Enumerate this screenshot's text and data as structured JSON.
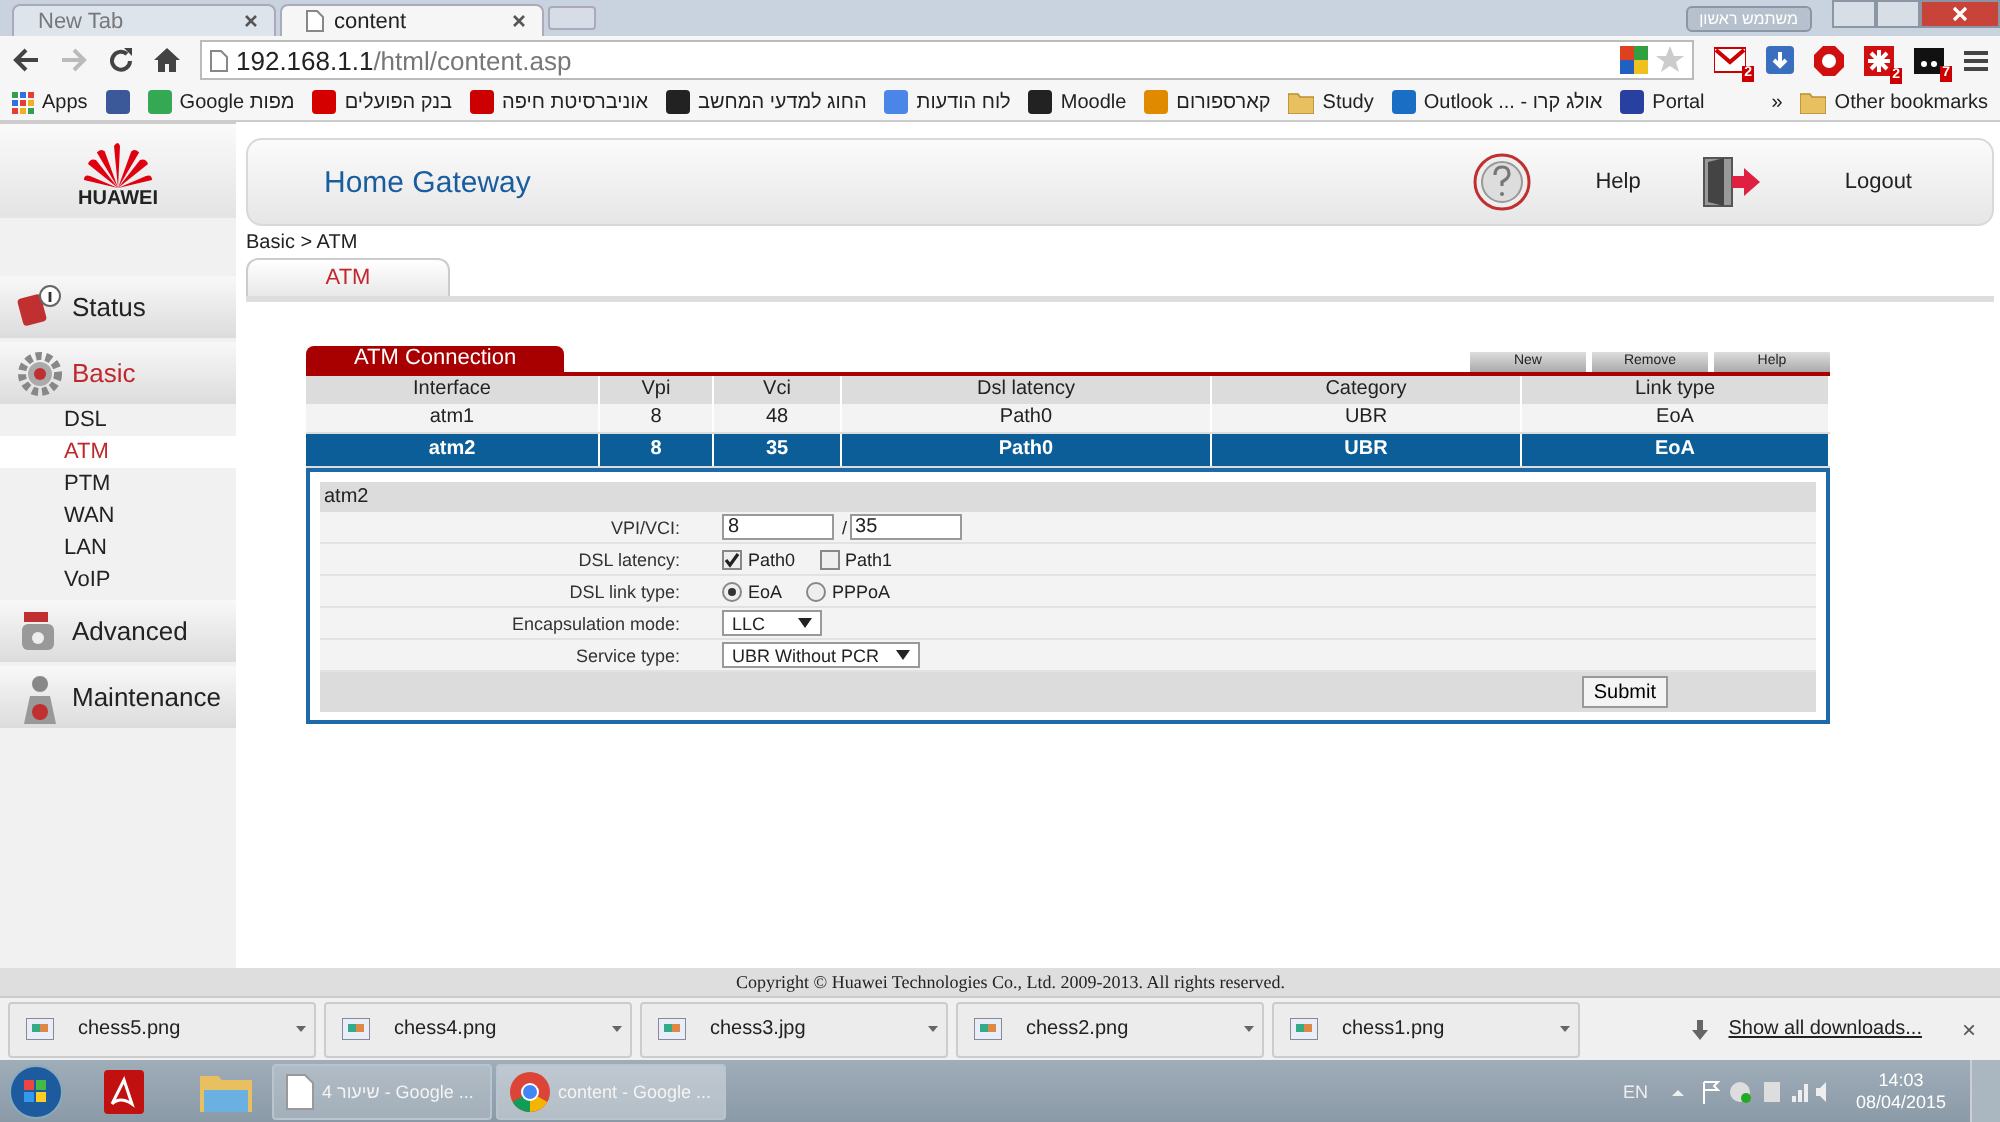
{
  "browser": {
    "tabs": [
      {
        "title": "New Tab",
        "selected": false
      },
      {
        "title": "content",
        "selected": true
      }
    ],
    "profile": "משתמש ראשון",
    "address": {
      "host": "192.168.1.1",
      "path": "/html/content.asp"
    },
    "extensions": [
      {
        "kind": "mail",
        "badge": "2"
      },
      {
        "kind": "download"
      },
      {
        "kind": "stop"
      },
      {
        "kind": "puzzle",
        "badge": "2"
      },
      {
        "kind": "dark",
        "badge": "7"
      }
    ],
    "bookmarks": [
      {
        "label": "Apps",
        "kind": "apps"
      },
      {
        "kind": "facebook"
      },
      {
        "label": "Google מפות",
        "kind": "maps"
      },
      {
        "label": "בנק הפועלים",
        "kind": "bank"
      },
      {
        "label": "אוניברסיטת חיפה",
        "kind": "uni"
      },
      {
        "label": "החוג למדעי המחשב",
        "kind": "joomla"
      },
      {
        "label": "לוח הודעות",
        "kind": "google"
      },
      {
        "label": "Moodle",
        "kind": "moodle"
      },
      {
        "label": "קארספורום",
        "kind": "car"
      },
      {
        "label": "Study",
        "kind": "folder"
      },
      {
        "label": "Outlook ... - אולג קרו",
        "kind": "outlook"
      },
      {
        "label": "Portal",
        "kind": "portal"
      }
    ],
    "overflow": "»",
    "other_bookmarks": "Other bookmarks"
  },
  "router": {
    "brand": "HUAWEI",
    "title": "Home Gateway",
    "help": "Help",
    "logout": "Logout",
    "breadcrumb": "Basic > ATM",
    "sidebar": [
      {
        "label": "Status",
        "selected": false
      },
      {
        "label": "Basic",
        "selected": true,
        "children": [
          {
            "label": "DSL",
            "selected": false
          },
          {
            "label": "ATM",
            "selected": true
          },
          {
            "label": "PTM",
            "selected": false
          },
          {
            "label": "WAN",
            "selected": false
          },
          {
            "label": "LAN",
            "selected": false
          },
          {
            "label": "VoIP",
            "selected": false
          }
        ]
      },
      {
        "label": "Advanced",
        "selected": false
      },
      {
        "label": "Maintenance",
        "selected": false
      }
    ],
    "page_tabs": [
      {
        "label": "ATM",
        "selected": true
      }
    ],
    "atm": {
      "title": "ATM Connection",
      "buttons": [
        "New",
        "Remove",
        "Help"
      ],
      "columns": [
        "Interface",
        "Vpi",
        "Vci",
        "Dsl latency",
        "Category",
        "Link type"
      ],
      "rows": [
        {
          "cells": [
            "atm1",
            "8",
            "48",
            "Path0",
            "UBR",
            "EoA"
          ],
          "selected": false
        },
        {
          "cells": [
            "atm2",
            "8",
            "35",
            "Path0",
            "UBR",
            "EoA"
          ],
          "selected": true
        }
      ],
      "detail": {
        "title": "atm2",
        "fields": [
          {
            "label": "VPI/VCI:",
            "kind": "pair",
            "value": "8",
            "separator": "/",
            "value2": "35"
          },
          {
            "label": "DSL latency:",
            "kind": "checks",
            "options": [
              {
                "label": "Path0",
                "checked": true
              },
              {
                "label": "Path1",
                "checked": false
              }
            ]
          },
          {
            "label": "DSL link type:",
            "kind": "radios",
            "options": [
              {
                "label": "EoA",
                "selected": true
              },
              {
                "label": "PPPoA",
                "selected": false
              }
            ]
          },
          {
            "label": "Encapsulation mode:",
            "kind": "select",
            "value": "LLC"
          },
          {
            "label": "Service type:",
            "kind": "select",
            "value": "UBR Without PCR"
          }
        ],
        "submit": "Submit"
      }
    },
    "copyright": "Copyright © Huawei Technologies Co., Ltd. 2009-2013. All rights reserved."
  },
  "downloads": {
    "items": [
      {
        "name": "chess5.png"
      },
      {
        "name": "chess4.png"
      },
      {
        "name": "chess3.jpg"
      },
      {
        "name": "chess2.png"
      },
      {
        "name": "chess1.png"
      }
    ],
    "show_all": "Show all downloads...",
    "close": "×"
  },
  "taskbar": {
    "windows": [
      {
        "label": "שיעור 4 - Google ...",
        "selected": false
      },
      {
        "label": "content - Google ...",
        "selected": true
      }
    ],
    "language": "EN",
    "time": "14:03",
    "date": "08/04/2015"
  }
}
